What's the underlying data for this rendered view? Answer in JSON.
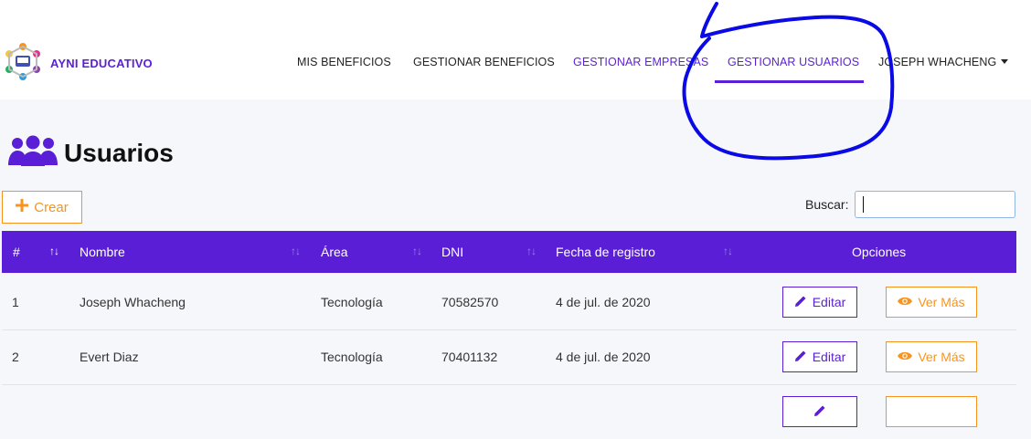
{
  "brand": {
    "name": "AYNI EDUCATIVO",
    "logo_icon": "logo-icon"
  },
  "nav": {
    "items": [
      {
        "label": "MIS BENEFICIOS"
      },
      {
        "label": "GESTIONAR BENEFICIOS"
      },
      {
        "label": "GESTIONAR EMPRESAS"
      },
      {
        "label": "GESTIONAR USUARIOS",
        "active": true
      },
      {
        "label": "JOSEPH WHACHENG",
        "dropdown": true
      }
    ]
  },
  "page": {
    "title": "Usuarios",
    "title_icon": "users-icon"
  },
  "controls": {
    "create_label": "Crear",
    "search_label": "Buscar:",
    "search_value": ""
  },
  "table": {
    "headers": [
      "#",
      "Nombre",
      "Área",
      "DNI",
      "Fecha de registro",
      "Opciones"
    ],
    "rows": [
      {
        "num": "1",
        "name": "Joseph Whacheng",
        "area": "Tecnología",
        "dni": "70582570",
        "date": "4 de jul. de 2020"
      },
      {
        "num": "2",
        "name": "Evert Diaz",
        "area": "Tecnología",
        "dni": "70401132",
        "date": "4 de jul. de 2020"
      }
    ],
    "edit_label": "Editar",
    "view_label": "Ver Más"
  },
  "colors": {
    "primary": "#5a1ed6",
    "accent": "#f7941d",
    "annotation": "#0a0ae6"
  }
}
